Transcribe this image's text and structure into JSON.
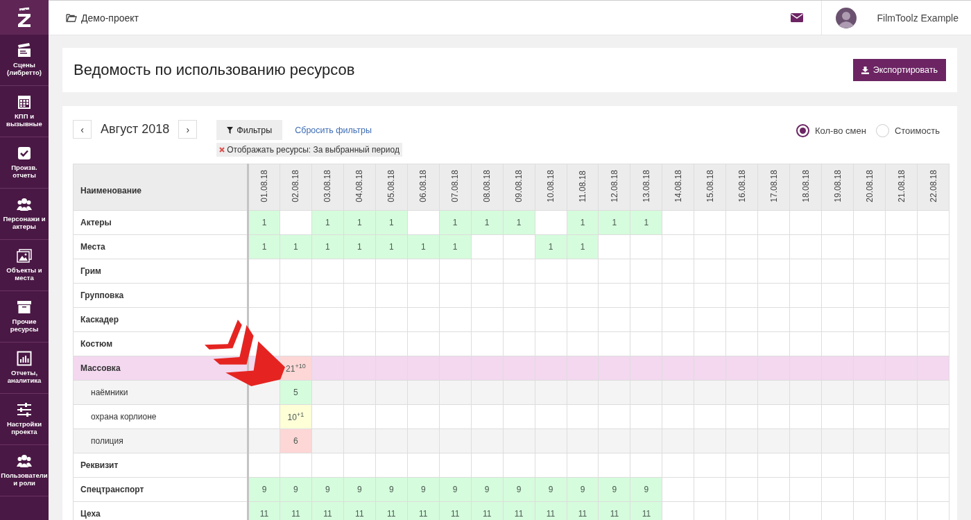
{
  "sidebar": {
    "items": [
      {
        "label": "Сцены (либретто)",
        "selected": false
      },
      {
        "label": "КПП и вызывные",
        "selected": false
      },
      {
        "label": "Произв. отчеты",
        "selected": false
      },
      {
        "label": "Персонажи и актеры",
        "selected": false
      },
      {
        "label": "Объекты и места",
        "selected": false
      },
      {
        "label": "Прочие ресурсы",
        "selected": false
      },
      {
        "label": "Отчеты, аналитика",
        "selected": false
      },
      {
        "label": "Настройки проекта",
        "selected": false
      },
      {
        "label": "Пользователи и роли",
        "selected": false
      }
    ]
  },
  "header": {
    "project": "Демо-проект",
    "user": "FilmToolz Example"
  },
  "page": {
    "title": "Ведомость по использованию ресурсов",
    "export_button": "Экспортировать"
  },
  "toolbar": {
    "prev": "‹",
    "month": "Август 2018",
    "next": "›",
    "filters_button": "Фильтры",
    "reset_link": "Сбросить фильтры",
    "filter_tags": [
      {
        "label": "Отображать ресурсы:",
        "value": "За выбранный период"
      }
    ],
    "modes": [
      {
        "label": "Кол-во смен",
        "selected": true
      },
      {
        "label": "Стоимость",
        "selected": false
      }
    ]
  },
  "table": {
    "name_column": "Наименование",
    "columns": [
      "01.08.18",
      "02.08.18",
      "03.08.18",
      "04.08.18",
      "05.08.18",
      "06.08.18",
      "07.08.18",
      "08.08.18",
      "09.08.18",
      "10.08.18",
      "11.08.18",
      "12.08.18",
      "13.08.18",
      "14.08.18",
      "15.08.18",
      "16.08.18",
      "17.08.18",
      "18.08.18",
      "19.08.18",
      "20.08.18",
      "21.08.18",
      "22.08.18"
    ],
    "rows": [
      {
        "name": "Актеры",
        "selected": false,
        "cells": [
          {
            "value": "1",
            "color": "#d5fcdc"
          },
          null,
          {
            "value": "1",
            "color": "#d5fcdc"
          },
          {
            "value": "1",
            "color": "#d5fcdc"
          },
          {
            "value": "1",
            "color": "#d5fcdc"
          },
          null,
          {
            "value": "1",
            "color": "#d5fcdc"
          },
          {
            "value": "1",
            "color": "#d5fcdc"
          },
          {
            "value": "1",
            "color": "#d5fcdc"
          },
          null,
          {
            "value": "1",
            "color": "#d5fcdc"
          },
          {
            "value": "1",
            "color": "#d5fcdc"
          },
          {
            "value": "1",
            "color": "#d5fcdc"
          }
        ]
      },
      {
        "name": "Места",
        "selected": false,
        "cells": [
          {
            "value": "1",
            "color": "#d5fcdc"
          },
          {
            "value": "1",
            "color": "#d5fcdc"
          },
          {
            "value": "1",
            "color": "#d5fcdc"
          },
          {
            "value": "1",
            "color": "#d5fcdc"
          },
          {
            "value": "1",
            "color": "#d5fcdc"
          },
          {
            "value": "1",
            "color": "#d5fcdc"
          },
          {
            "value": "1",
            "color": "#d5fcdc"
          },
          null,
          null,
          {
            "value": "1",
            "color": "#d5fcdc"
          },
          {
            "value": "1",
            "color": "#d5fcdc"
          }
        ]
      },
      {
        "name": "Грим",
        "selected": false,
        "cells": []
      },
      {
        "name": "Групповка",
        "selected": false,
        "cells": []
      },
      {
        "name": "Каскадер",
        "selected": false,
        "cells": []
      },
      {
        "name": "Костюм",
        "selected": false,
        "cells": []
      },
      {
        "name": "Массовка",
        "selected": true,
        "cells": [
          null,
          {
            "value": "21$^{+10}$",
            "color": "#fdd6d6"
          }
        ],
        "children": [
          {
            "name": "наёмники",
            "selected": false,
            "cells": [
              null,
              {
                "value": "5",
                "color": "#d5fcdc"
              }
            ]
          },
          {
            "name": "охрана корлионе",
            "selected": false,
            "cells": [
              null,
              {
                "value": "10$^{+1}$",
                "color": "#fefed7"
              }
            ]
          },
          {
            "name": "полиция",
            "selected": false,
            "cells": [
              null,
              {
                "value": "6",
                "color": "#fdd6d6"
              }
            ]
          }
        ]
      },
      {
        "name": "Реквизит",
        "selected": false,
        "cells": []
      },
      {
        "name": "Спецтранспорт",
        "selected": false,
        "cells": [
          {
            "value": "9",
            "color": "#d5fcdc"
          },
          {
            "value": "9",
            "color": "#d5fcdc"
          },
          {
            "value": "9",
            "color": "#d5fcdc"
          },
          {
            "value": "9",
            "color": "#d5fcdc"
          },
          {
            "value": "9",
            "color": "#d5fcdc"
          },
          {
            "value": "9",
            "color": "#d5fcdc"
          },
          {
            "value": "9",
            "color": "#d5fcdc"
          },
          {
            "value": "9",
            "color": "#d5fcdc"
          },
          {
            "value": "9",
            "color": "#d5fcdc"
          },
          {
            "value": "9",
            "color": "#d5fcdc"
          },
          {
            "value": "9",
            "color": "#d5fcdc"
          },
          {
            "value": "9",
            "color": "#d5fcdc"
          },
          {
            "value": "9",
            "color": "#d5fcdc"
          }
        ]
      },
      {
        "name": "Цеха",
        "selected": false,
        "cells": [
          {
            "value": "11",
            "color": "#d5fcdc"
          },
          {
            "value": "11",
            "color": "#d5fcdc"
          },
          {
            "value": "11",
            "color": "#d5fcdc"
          },
          {
            "value": "11",
            "color": "#d5fcdc"
          },
          {
            "value": "11",
            "color": "#d5fcdc"
          },
          {
            "value": "11",
            "color": "#d5fcdc"
          },
          {
            "value": "11",
            "color": "#d5fcdc"
          },
          {
            "value": "11",
            "color": "#d5fcdc"
          },
          {
            "value": "11",
            "color": "#d5fcdc"
          },
          {
            "value": "11",
            "color": "#d5fcdc"
          },
          {
            "value": "11",
            "color": "#d5fcdc"
          },
          {
            "value": "11",
            "color": "#d5fcdc"
          },
          {
            "value": "11",
            "color": "#d5fcdc"
          }
        ]
      }
    ]
  },
  "annotation": {
    "kind": "arrow"
  }
}
